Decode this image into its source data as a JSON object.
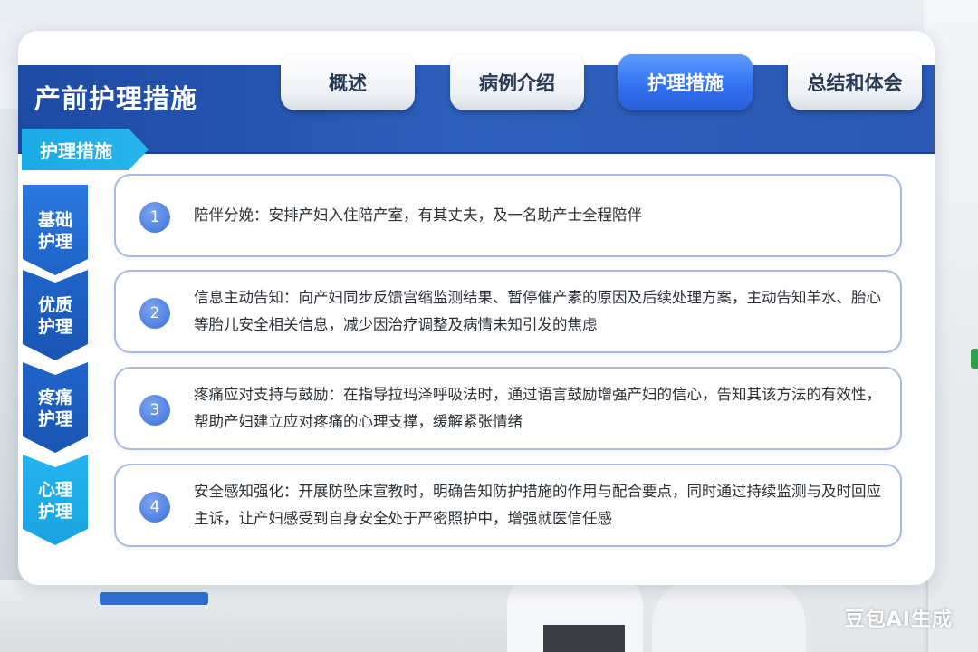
{
  "header": {
    "title": "产前护理措施",
    "tabs": [
      {
        "label": "概述",
        "active": false
      },
      {
        "label": "病例介绍",
        "active": false
      },
      {
        "label": "护理措施",
        "active": true
      },
      {
        "label": "总结和体会",
        "active": false
      }
    ]
  },
  "section_tag": "护理措施",
  "items": [
    {
      "category": "基础\n护理",
      "num": "1",
      "text": "陪伴分娩：安排产妇入住陪产室，有其丈夫，及一名助产士全程陪伴"
    },
    {
      "category": "优质\n护理",
      "num": "2",
      "text": "信息主动告知：向产妇同步反馈宫缩监测结果、暂停催产素的原因及后续处理方案，主动告知羊水、胎心等胎儿安全相关信息，减少因治疗调整及病情未知引发的焦虑"
    },
    {
      "category": "疼痛\n护理",
      "num": "3",
      "text": "疼痛应对支持与鼓励：在指导拉玛泽呼吸法时，通过语言鼓励增强产妇的信心，告知其该方法的有效性，帮助产妇建立应对疼痛的心理支撑，缓解紧张情绪"
    },
    {
      "category": "心理\n护理",
      "num": "4",
      "text": "安全感知强化：开展防坠床宣教时，明确告知防护措施的作用与配合要点，同时通过持续监测与及时回应主诉，让产妇感受到自身安全处于严密照护中，增强就医信任感"
    }
  ],
  "watermark": "豆包AI生成",
  "colors": {
    "header": "#2a58b4",
    "active_tab": "#2f6ff0",
    "tag": "#19a9e4",
    "card_border": "#aab9de"
  }
}
